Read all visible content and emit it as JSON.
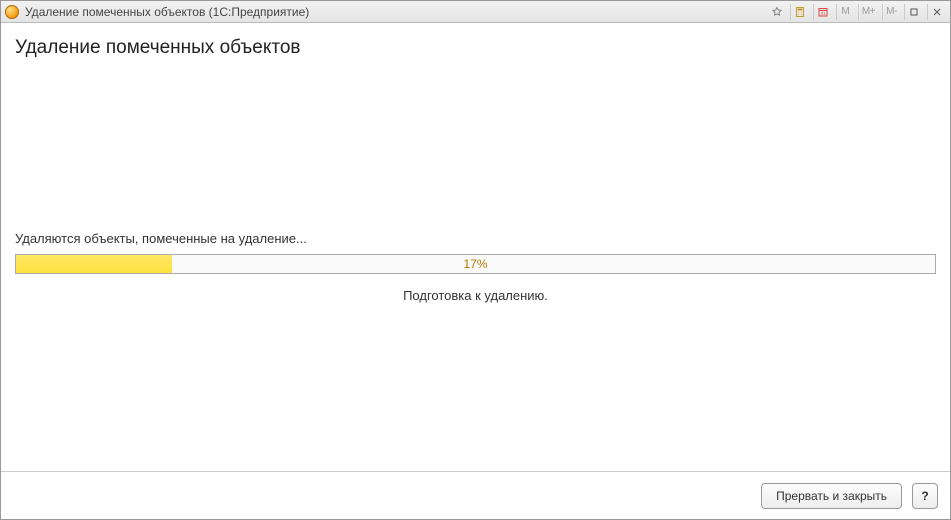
{
  "titlebar": {
    "title": "Удаление помеченных объектов  (1С:Предприятие)",
    "m_buttons": [
      "M",
      "M+",
      "M-"
    ]
  },
  "page": {
    "heading": "Удаление помеченных объектов"
  },
  "progress": {
    "status_text": "Удаляются объекты, помеченные на удаление...",
    "percent": 17,
    "percent_label": "17%",
    "fill_width": "17%",
    "sub_text": "Подготовка к удалению."
  },
  "footer": {
    "abort_label": "Прервать и закрыть",
    "help_label": "?"
  }
}
